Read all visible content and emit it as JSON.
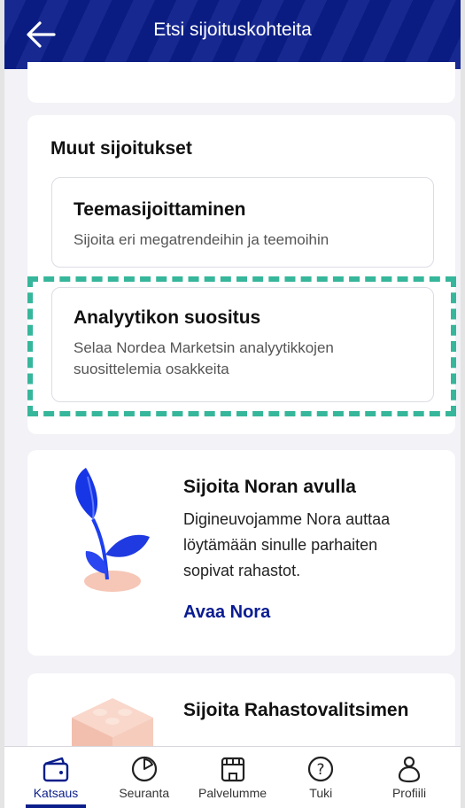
{
  "header": {
    "title": "Etsi sijoituskohteita",
    "back_icon": "arrow-left-icon"
  },
  "muut": {
    "title": "Muut sijoitukset",
    "options": [
      {
        "title": "Teemasijoittaminen",
        "desc": "Sijoita eri megatrendeihin ja teemoihin"
      },
      {
        "title": "Analyytikon suositus",
        "desc": "Selaa Nordea Marketsin analyytikkojen suosittelemia osakkeita"
      }
    ],
    "highlight_color": "#36b69a"
  },
  "nora": {
    "title": "Sijoita Noran avulla",
    "desc": "Digineuvojamme Nora auttaa löytämään sinulle parhaiten sopivat rahastot.",
    "link": "Avaa Nora"
  },
  "rahasto": {
    "title": "Sijoita Rahastovalitsimen"
  },
  "tabbar": {
    "tabs": [
      {
        "label": "Katsaus",
        "icon": "wallet-icon",
        "active": true
      },
      {
        "label": "Seuranta",
        "icon": "pie-chart-icon",
        "active": false
      },
      {
        "label": "Palvelumme",
        "icon": "store-icon",
        "active": false
      },
      {
        "label": "Tuki",
        "icon": "help-circle-icon",
        "active": false
      },
      {
        "label": "Profiili",
        "icon": "person-icon",
        "active": false
      }
    ]
  },
  "colors": {
    "brand": "#0b1e8a",
    "accent": "#36b69a"
  }
}
